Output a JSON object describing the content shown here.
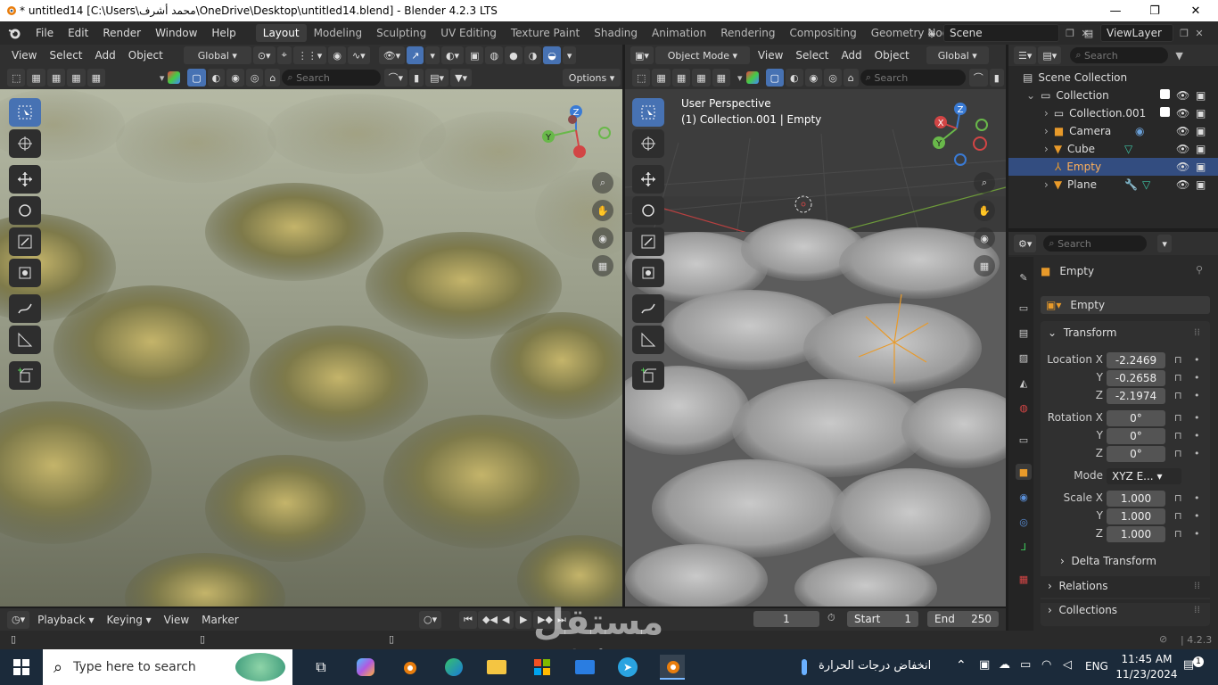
{
  "window": {
    "title": "* untitled14 [C:\\Users\\محمد أشرف\\OneDrive\\Desktop\\untitled14.blend] - Blender 4.2.3 LTS",
    "minimize": "—",
    "maximize": "❐",
    "close": "✕"
  },
  "menus": [
    "File",
    "Edit",
    "Render",
    "Window",
    "Help"
  ],
  "workspaces": [
    "Layout",
    "Modeling",
    "Sculpting",
    "UV Editing",
    "Texture Paint",
    "Shading",
    "Animation",
    "Rendering",
    "Compositing",
    "Geometry Node"
  ],
  "scene": "Scene",
  "view_layer": "ViewLayer",
  "left_viewport": {
    "menus": [
      "View",
      "Select",
      "Add",
      "Object"
    ],
    "orientation": "Global",
    "search_placeholder": "Search",
    "options_label": "Options"
  },
  "right_viewport": {
    "mode": "Object Mode",
    "menus": [
      "View",
      "Select",
      "Add",
      "Object"
    ],
    "orientation": "Global",
    "search_placeholder": "Search",
    "overlay_title": "User Perspective",
    "overlay_sub": "(1) Collection.001 | Empty"
  },
  "gizmo": {
    "x": "X",
    "y": "Y",
    "z": "Z"
  },
  "outliner": {
    "search_placeholder": "Search",
    "rows": [
      {
        "label": "Scene Collection"
      },
      {
        "label": "Collection"
      },
      {
        "label": "Collection.001"
      },
      {
        "label": "Camera"
      },
      {
        "label": "Cube"
      },
      {
        "label": "Empty"
      },
      {
        "label": "Plane"
      }
    ]
  },
  "properties": {
    "search_placeholder": "Search",
    "object_name": "Empty",
    "data_name": "Empty",
    "transform_label": "Transform",
    "location_label": "Location X",
    "y_label": "Y",
    "z_label": "Z",
    "location": [
      "-2.2469",
      "-0.2658",
      "-2.1974"
    ],
    "rotation_label": "Rotation X",
    "rotation": [
      "0°",
      "0°",
      "0°"
    ],
    "mode_label": "Mode",
    "mode_value": "XYZ E...",
    "scale_label": "Scale X",
    "scale": [
      "1.000",
      "1.000",
      "1.000"
    ],
    "delta_label": "Delta Transform",
    "relations_label": "Relations",
    "collections_label": "Collections"
  },
  "timeline": {
    "menus": [
      "Playback",
      "Keying",
      "View",
      "Marker"
    ],
    "current_frame": "1",
    "start_label": "Start",
    "start": "1",
    "end_label": "End",
    "end": "250"
  },
  "status": {
    "version": "4.2.3"
  },
  "taskbar": {
    "search_placeholder": "Type here to search",
    "weather": "انخفاض درجات الحرارة",
    "lang": "ENG",
    "time": "11:45 AM",
    "date": "11/23/2024",
    "notif": "1"
  },
  "watermark": {
    "text": "مستقل",
    "sub": "mostaql.com"
  }
}
